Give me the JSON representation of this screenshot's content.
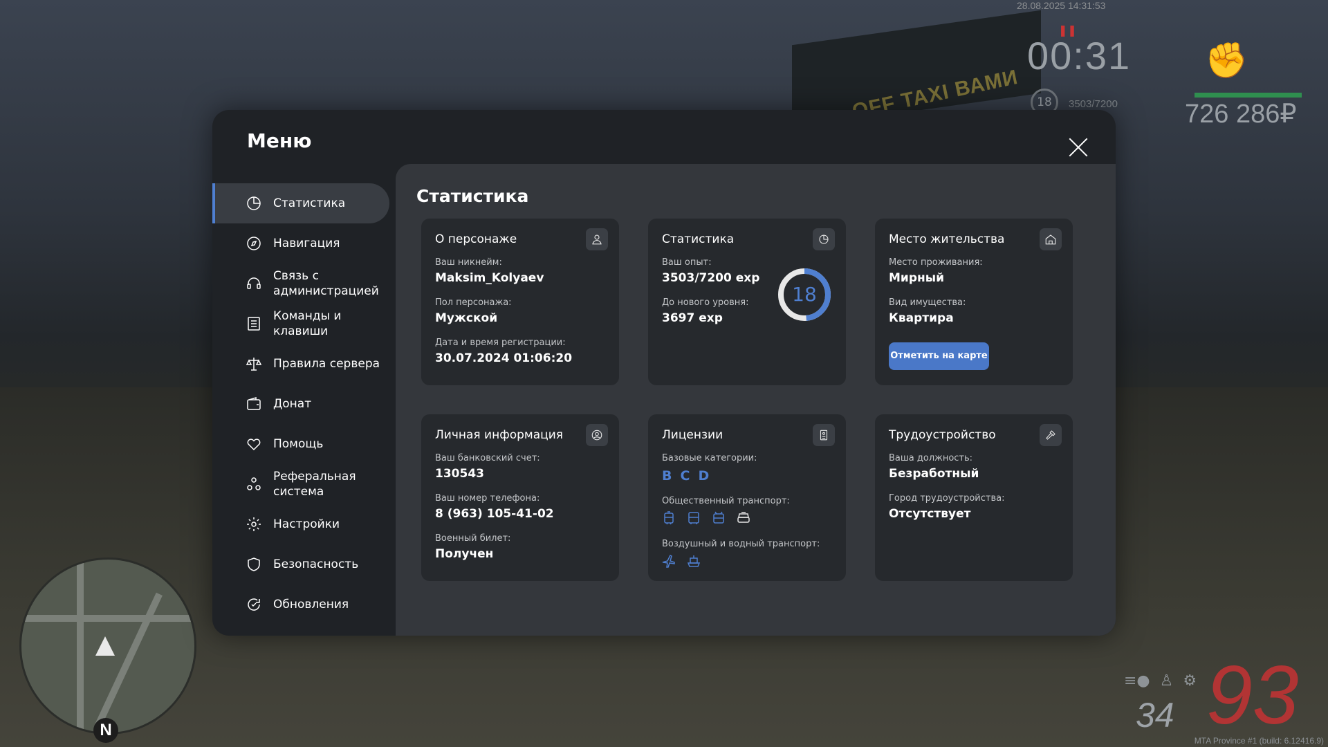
{
  "hud": {
    "date": "28.08.2025 14:31:53",
    "timer": "00:31",
    "level": "18",
    "exp": "3503/7200",
    "money": "726 286₽",
    "speed": "93",
    "fuel": "34",
    "build": "MTA Province #1 (build: 6.12416.9)",
    "billboard": "OFF TAXI ВАМИ",
    "compass": "N",
    "health_pct": 100
  },
  "menu": {
    "title": "Меню",
    "sidebar": [
      {
        "label": "Статистика",
        "icon": "chart-pie-icon"
      },
      {
        "label": "Навигация",
        "icon": "compass-icon"
      },
      {
        "label": "Связь с администрацией",
        "icon": "headset-icon"
      },
      {
        "label": "Команды и клавиши",
        "icon": "list-icon"
      },
      {
        "label": "Правила сервера",
        "icon": "scales-icon"
      },
      {
        "label": "Донат",
        "icon": "wallet-icon"
      },
      {
        "label": "Помощь",
        "icon": "heart-hand-icon"
      },
      {
        "label": "Реферальная система",
        "icon": "people-icon"
      },
      {
        "label": "Настройки",
        "icon": "gear-icon"
      },
      {
        "label": "Безопасность",
        "icon": "shield-icon"
      },
      {
        "label": "Обновления",
        "icon": "refresh-icon"
      }
    ]
  },
  "content": {
    "title": "Статистика",
    "character": {
      "title": "О персонаже",
      "nick_label": "Ваш никнейм:",
      "nick": "Maksim_Kolyaev",
      "gender_label": "Пол персонажа:",
      "gender": "Мужской",
      "reg_label": "Дата и время регистрации:",
      "reg": "30.07.2024 01:06:20"
    },
    "stats": {
      "title": "Статистика",
      "exp_label": "Ваш опыт:",
      "exp": "3503/7200 exp",
      "next_label": "До нового уровня:",
      "next": "3697 exp",
      "level": "18",
      "progress": 0.4865
    },
    "residence": {
      "title": "Место жительства",
      "place_label": "Место проживания:",
      "place": "Мирный",
      "type_label": "Вид имущества:",
      "type": "Квартира",
      "button": "Отметить на карте"
    },
    "personal": {
      "title": "Личная информация",
      "bank_label": "Ваш банковский счет:",
      "bank": "130543",
      "phone_label": "Ваш номер телефона:",
      "phone": "8 (963) 105-41-02",
      "military_label": "Военный билет:",
      "military": "Получен"
    },
    "licenses": {
      "title": "Лицензии",
      "base_label": "Базовые категории:",
      "categories": [
        "B",
        "C",
        "D"
      ],
      "public_label": "Общественный транспорт:",
      "air_label": "Воздушный и водный транспорт:"
    },
    "job": {
      "title": "Трудоустройство",
      "position_label": "Ваша должность:",
      "position": "Безработный",
      "city_label": "Город трудоустройства:",
      "city": "Отсутствует"
    }
  },
  "colors": {
    "accent": "#4f7fd0",
    "modal": "#1f2226",
    "panel": "#34373c",
    "card": "#26292d"
  }
}
